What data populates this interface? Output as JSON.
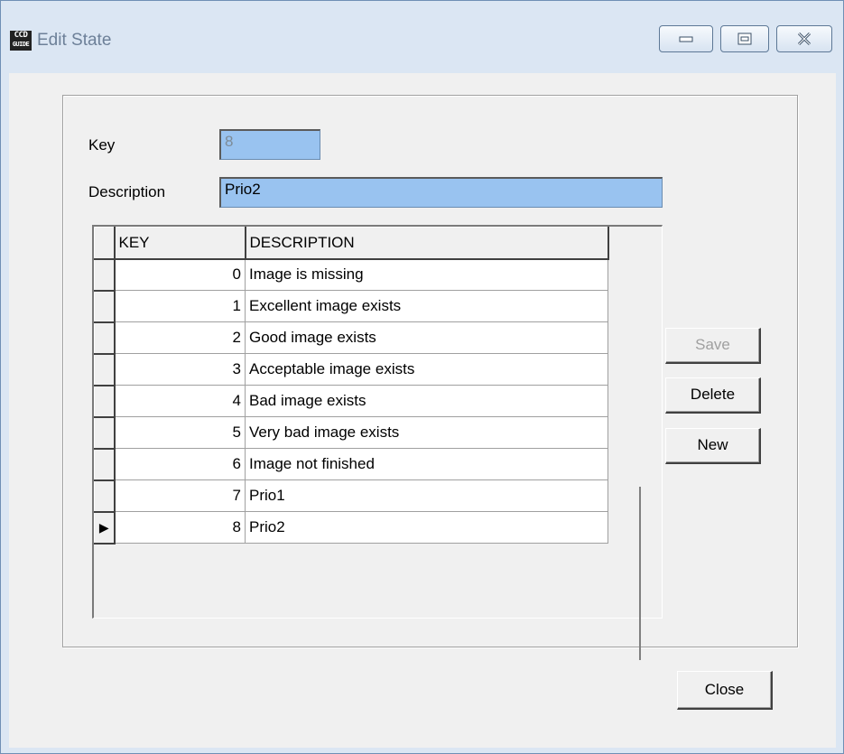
{
  "window": {
    "title": "Edit State",
    "icon_text_top": "CCD",
    "icon_text_bottom": "GUIDE"
  },
  "form": {
    "key_label": "Key",
    "key_value": "8",
    "description_label": "Description",
    "description_value": "Prio2"
  },
  "grid": {
    "columns": [
      "KEY",
      "DESCRIPTION"
    ],
    "rows": [
      {
        "key": "0",
        "description": "Image is missing"
      },
      {
        "key": "1",
        "description": "Excellent image exists"
      },
      {
        "key": "2",
        "description": "Good image exists"
      },
      {
        "key": "3",
        "description": "Acceptable image exists"
      },
      {
        "key": "4",
        "description": "Bad image exists"
      },
      {
        "key": "5",
        "description": "Very bad image exists"
      },
      {
        "key": "6",
        "description": "Image not finished"
      },
      {
        "key": "7",
        "description": "Prio1"
      },
      {
        "key": "8",
        "description": "Prio2"
      }
    ],
    "current_row_indicator": "▶"
  },
  "buttons": {
    "save": "Save",
    "delete": "Delete",
    "new": "New",
    "close": "Close"
  }
}
